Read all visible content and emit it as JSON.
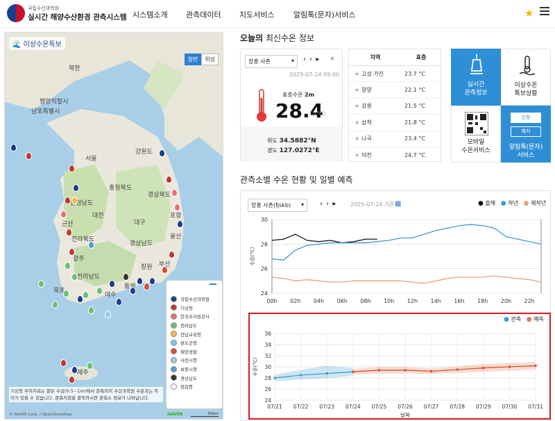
{
  "header": {
    "org_small": "국립수산과학원",
    "org_title": "실시간 해양수산환경 관측시스템",
    "nav": [
      "시스템소개",
      "관측데이터",
      "지도서비스",
      "알림톡(문자)서비스"
    ]
  },
  "map": {
    "title": "이상수온특보",
    "toggle": [
      "일반",
      "위성"
    ],
    "labels": [
      "북한",
      "평양직할시",
      "남포특별시",
      "서울",
      "강원도",
      "충청북도",
      "충청남도",
      "경상북도",
      "대전",
      "경상남도",
      "전라북도",
      "광주",
      "전라남도",
      "부산",
      "대구",
      "울산",
      "군산",
      "목포",
      "여수",
      "창원",
      "포항",
      "통영",
      "제주"
    ],
    "legend": [
      "국립수산과학원",
      "기상청",
      "한국수자원공사",
      "전라남도",
      "전남교육청",
      "완도군청",
      "해양경찰",
      "사천시청",
      "보령시청",
      "경상남도",
      "점검중"
    ],
    "note": "기상청 부이자료는 얕은 수심(0.5~1m)에서 관측되어 수산과학원 수온과는 차이가 있을 수 있습니다. 관측지점을 클릭하시면 관측소 정보가 나타납니다.",
    "credit": "© NAVER Corp. / OpenStreetMap",
    "naver": "NAVER",
    "scale": "50km"
  },
  "today": {
    "title_bold": "오늘의",
    "title_rest": " 최신수온 정보",
    "station": "장흥 사촌",
    "arrows": "‹ › ▸",
    "datetime": "2025-07-24 09:00",
    "depth_label": "표층수온",
    "depth_value": "2m",
    "temp": "28.4",
    "unit": "(°C)",
    "lat_label": "위도",
    "lat": "34.5882°N",
    "lon_label": "경도",
    "lon": "127.0272°E"
  },
  "table": {
    "headers": [
      "지역",
      "표층"
    ],
    "rows": [
      {
        "region": "고성 가진",
        "temp": "23.7 °C"
      },
      {
        "region": "양양",
        "temp": "22.1 °C"
      },
      {
        "region": "강릉",
        "temp": "21.5 °C"
      },
      {
        "region": "삼척",
        "temp": "21.8 °C"
      },
      {
        "region": "나곡",
        "temp": "23.4 °C"
      },
      {
        "region": "덕천",
        "temp": "24.7 °C"
      }
    ]
  },
  "tiles": {
    "realtime": "실시간\n관측정보",
    "anomaly": "이상수온\n특보상황",
    "mobile": "모바일\n수온서비스",
    "alert": "알림톡(문자)\n서비스",
    "apply": "신청",
    "cancel": "해지"
  },
  "forecast": {
    "title": "관측소별 수온 현황 및 일별 예측",
    "station": "장흥 사촌(fjskb)",
    "arrows": "‹ › ▸",
    "date": "2025-07-24 기준",
    "legend": [
      "올해",
      "작년",
      "재작년"
    ],
    "legend_colors": [
      "#111111",
      "#3a9bd5",
      "#e8a07a"
    ],
    "legend2": [
      "관측",
      "예측"
    ],
    "legend2_colors": [
      "#3a9bd5",
      "#e8744a"
    ]
  },
  "chart_data": [
    {
      "type": "line",
      "x": [
        "00h",
        "01h",
        "02h",
        "03h",
        "04h",
        "05h",
        "06h",
        "07h",
        "08h",
        "09h",
        "10h",
        "11h",
        "12h",
        "13h",
        "14h",
        "15h",
        "16h",
        "17h",
        "18h",
        "19h",
        "20h",
        "21h",
        "22h",
        "23h"
      ],
      "xticks": [
        "00h",
        "02h",
        "04h",
        "06h",
        "08h",
        "10h",
        "12h",
        "14h",
        "16h",
        "18h",
        "20h",
        "22h"
      ],
      "ylabel": "수온(°C)",
      "ylim": [
        24,
        30
      ],
      "yticks": [
        24,
        26,
        28,
        30
      ],
      "series": [
        {
          "name": "올해",
          "color": "#111111",
          "values": [
            28.3,
            28.4,
            28.8,
            28.3,
            28.2,
            28.3,
            28.1,
            28.2,
            28.4,
            28.4
          ]
        },
        {
          "name": "작년",
          "color": "#3a9bd5",
          "values": [
            26.8,
            26.7,
            27.5,
            27.9,
            28.0,
            28.1,
            28.1,
            28.1,
            28.1,
            28.2,
            28.3,
            28.5,
            28.5,
            28.8,
            29.1,
            29.3,
            29.5,
            29.6,
            29.5,
            29.3,
            28.6,
            28.4,
            28.2,
            28.0
          ]
        },
        {
          "name": "재작년",
          "color": "#e8a07a",
          "values": [
            25.3,
            25.2,
            25.0,
            25.1,
            25.0,
            24.9,
            24.9,
            25.0,
            25.0,
            25.0,
            25.0,
            25.0,
            24.9,
            24.8,
            25.0,
            25.2,
            25.3,
            25.3,
            25.3,
            25.4,
            25.3,
            25.2,
            25.1,
            24.9
          ]
        }
      ]
    },
    {
      "type": "line",
      "x": [
        "07/21",
        "07/22",
        "07/23",
        "07/24",
        "07/25",
        "07/26",
        "07/27",
        "07/28",
        "07/29",
        "07/30",
        "07/31"
      ],
      "xlabel": "날짜",
      "ylabel": "수온(°C)",
      "ylim": [
        24,
        36
      ],
      "yticks": [
        24,
        26,
        28,
        30,
        32,
        34,
        36
      ],
      "series": [
        {
          "name": "관측",
          "color": "#3a9bd5",
          "values": [
            28.0,
            28.5,
            28.8,
            29.1
          ],
          "band": [
            [
              27.4,
              28.6
            ],
            [
              27.7,
              29.5
            ],
            [
              27.9,
              30.2
            ],
            [
              28.4,
              29.8
            ]
          ]
        },
        {
          "name": "예측",
          "color": "#d9542c",
          "values": [
            29.1,
            29.4,
            29.4,
            29.2,
            29.5,
            29.8,
            30.0,
            30.2
          ],
          "band": [
            [
              28.6,
              29.6
            ],
            [
              28.8,
              30.0
            ],
            [
              28.8,
              30.0
            ],
            [
              28.7,
              29.7
            ],
            [
              28.9,
              30.1
            ],
            [
              29.1,
              30.5
            ],
            [
              29.3,
              30.7
            ],
            [
              29.5,
              30.9
            ]
          ]
        }
      ]
    }
  ]
}
